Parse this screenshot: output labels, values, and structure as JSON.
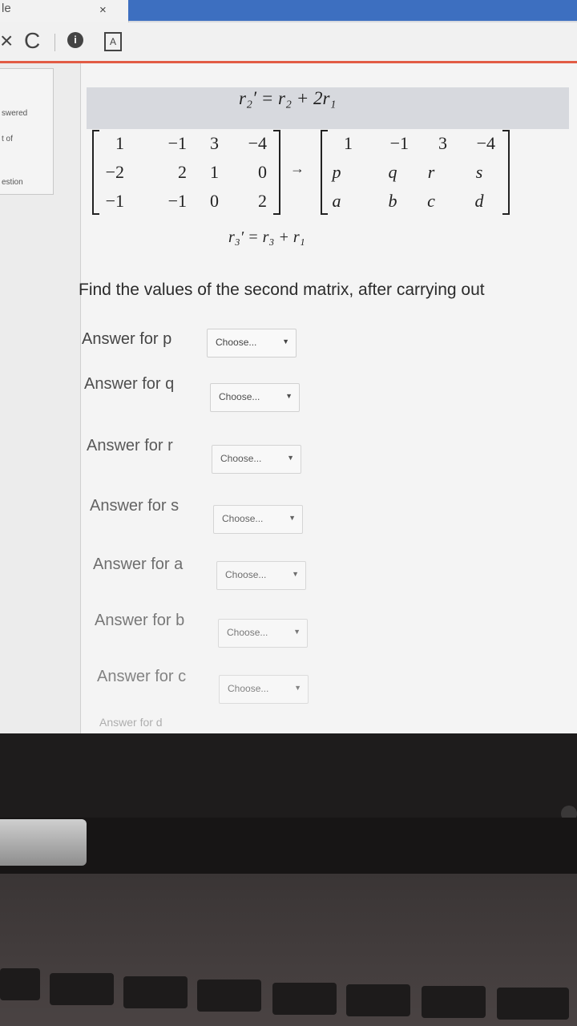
{
  "browser": {
    "tab_title": "le",
    "tab_close": "×",
    "nav_stop": "×",
    "nav_reload": "C",
    "nav_info": "ⓘ",
    "nav_ext": "A"
  },
  "sidebar": {
    "lines": [
      "swered",
      "t of",
      "estion"
    ]
  },
  "problem": {
    "op_top": "r₂′ = r₂ + 2r₁",
    "op_bottom": "r₃′ = r₃ + r₁",
    "matrix_original": [
      [
        "1",
        "−1",
        "3",
        "−4"
      ],
      [
        "−2",
        "2",
        "1",
        "0"
      ],
      [
        "−1",
        "−1",
        "0",
        "2"
      ]
    ],
    "matrix_result": [
      [
        "1",
        "−1",
        "3",
        "−4"
      ],
      [
        "p",
        "q",
        "r",
        "s"
      ],
      [
        "a",
        "b",
        "c",
        "d"
      ]
    ],
    "arrow": "→",
    "question": "Find the values of the second matrix, after carrying out"
  },
  "answers": [
    {
      "label": "Answer for p",
      "select": "Choose..."
    },
    {
      "label": "Answer for q",
      "select": "Choose..."
    },
    {
      "label": "Answer for r",
      "select": "Choose..."
    },
    {
      "label": "Answer for s",
      "select": "Choose..."
    },
    {
      "label": "Answer for a",
      "select": "Choose..."
    },
    {
      "label": "Answer for b",
      "select": "Choose..."
    },
    {
      "label": "Answer for c",
      "select": "Choose..."
    },
    {
      "label": "Answer for d",
      "select": ""
    }
  ],
  "colors": {
    "accent_line": "#e25c45",
    "tab_strip": "#3d6fc0",
    "formula_bar": "#d7d9de"
  }
}
